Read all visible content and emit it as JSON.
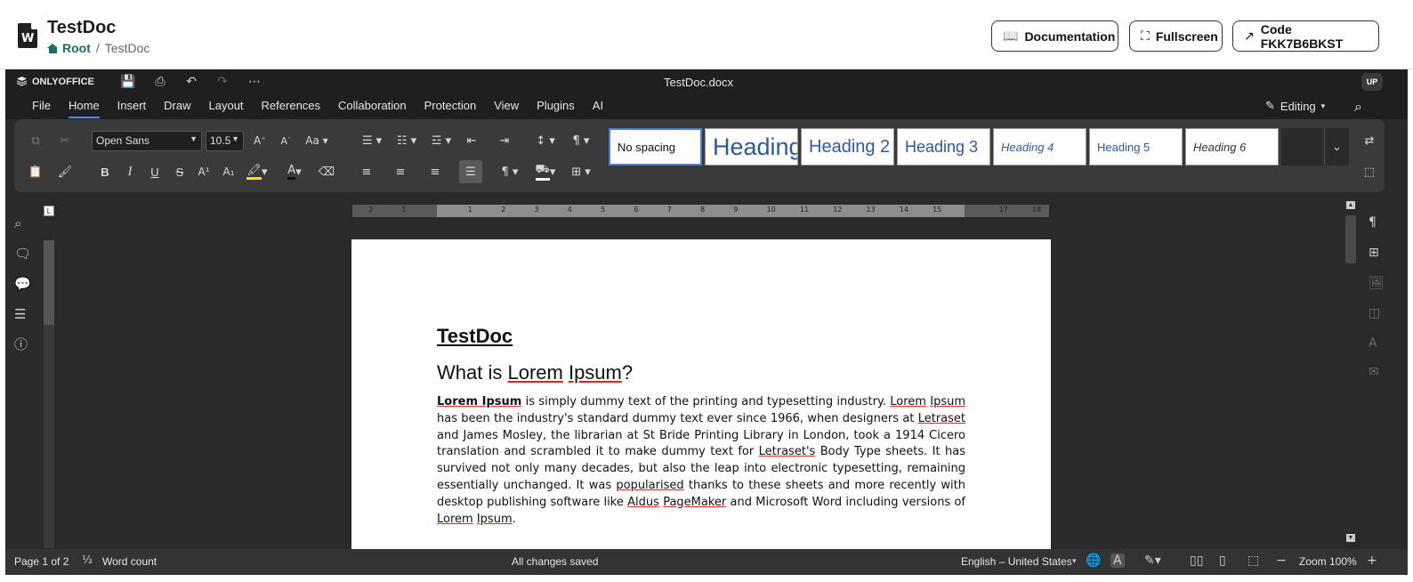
{
  "header": {
    "title": "TestDoc",
    "doc_icon_letter": "W",
    "breadcrumb": {
      "root": "Root",
      "separator": "/",
      "current": "TestDoc"
    },
    "buttons": {
      "documentation": "Documentation",
      "fullscreen": "Fullscreen",
      "code": "Code FKK7B6BKST"
    }
  },
  "editor": {
    "brand": "ONLYOFFICE",
    "document_name": "TestDoc.docx",
    "user_initials": "UP",
    "menu": [
      "File",
      "Home",
      "Insert",
      "Draw",
      "Layout",
      "References",
      "Collaboration",
      "Protection",
      "View",
      "Plugins",
      "AI"
    ],
    "active_menu": "Home",
    "mode": "Editing",
    "toolbar": {
      "font_family": "Open Sans",
      "font_size": "10.5",
      "styles": [
        "No spacing",
        "Heading",
        "Heading 2",
        "Heading 3",
        "Heading 4",
        "Heading 5",
        "Heading 6"
      ]
    },
    "document": {
      "title": "TestDoc",
      "heading_prefix": "What is ",
      "heading_w1": "Lorem",
      "heading_w2": "Ipsum",
      "heading_suffix": "?",
      "p": {
        "s1": "Lorem Ipsum",
        "t1": " is simply dummy text of the printing and typesetting industry. ",
        "s2": "Lorem",
        "t2": " ",
        "s3": "Ipsum",
        "t3": " has been the industry's standard dummy text ever since 1966, when designers at ",
        "s4": "Letraset",
        "t4": " and James Mosley, the librarian at St Bride Printing Library in London, took a 1914 Cicero translation and scrambled it to make dummy text for ",
        "s5": "Letraset's",
        "t5": " Body Type sheets. It has survived not only many decades, but also the leap into electronic typesetting, remaining essentially unchanged. It was ",
        "s6": "popularised",
        "t6": " thanks to these sheets and more recently with desktop publishing software like ",
        "s7": "Aldus",
        "t7": " ",
        "s8": "PageMaker",
        "t8": " and Microsoft Word including versions of ",
        "s9": "Lorem",
        "t9": " ",
        "s10": "Ipsum",
        "t10": "."
      }
    },
    "status": {
      "page": "Page 1 of 2",
      "word_count": "Word count",
      "save_state": "All changes saved",
      "language": "English – United States",
      "zoom": "Zoom 100%"
    }
  }
}
